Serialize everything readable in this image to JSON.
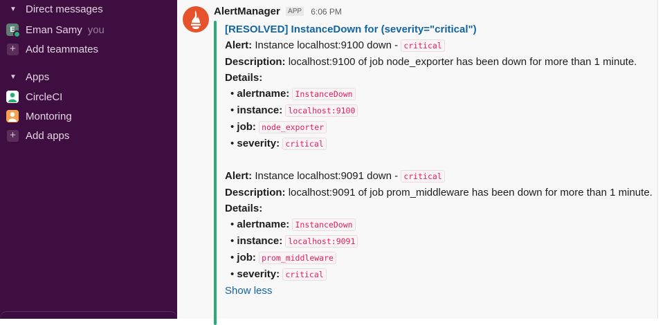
{
  "sidebar": {
    "direct_messages_label": "Direct messages",
    "user_avatar_letter": "E",
    "user_name": "Eman Samy",
    "user_you": "you",
    "add_teammates_label": "Add teammates",
    "apps_label": "Apps",
    "apps": [
      {
        "label": "CircleCI"
      },
      {
        "label": "Montoring"
      }
    ],
    "add_apps_label": "Add apps"
  },
  "message": {
    "sender": "AlertManager",
    "badge": "APP",
    "time": "6:06 PM",
    "title": "[RESOLVED] InstanceDown for  (severity=\"critical\")",
    "alerts": [
      {
        "alert_label": "Alert:",
        "alert_text": "Instance localhost:9100 down -",
        "alert_code": "critical",
        "desc_label": "Description:",
        "desc_text": "localhost:9100 of job node_exporter has been down for more than 1 minute.",
        "details_label": "Details:",
        "details": [
          {
            "key": "alertname:",
            "value": "InstanceDown"
          },
          {
            "key": "instance:",
            "value": "localhost:9100"
          },
          {
            "key": "job:",
            "value": "node_exporter"
          },
          {
            "key": "severity:",
            "value": "critical"
          }
        ]
      },
      {
        "alert_label": "Alert:",
        "alert_text": "Instance localhost:9091 down -",
        "alert_code": "critical",
        "desc_label": "Description:",
        "desc_text": "localhost:9091 of job prom_middleware has been down for more than 1 minute.",
        "details_label": "Details:",
        "details": [
          {
            "key": "alertname:",
            "value": "InstanceDown"
          },
          {
            "key": "instance:",
            "value": "localhost:9091"
          },
          {
            "key": "job:",
            "value": "prom_middleware"
          },
          {
            "key": "severity:",
            "value": "critical"
          }
        ]
      }
    ],
    "show_less": "Show less"
  },
  "colors": {
    "sidebar_bg": "#3f0e40",
    "attachment_bar": "#2bac76",
    "link": "#1264a3",
    "code": "#e01e5a"
  }
}
